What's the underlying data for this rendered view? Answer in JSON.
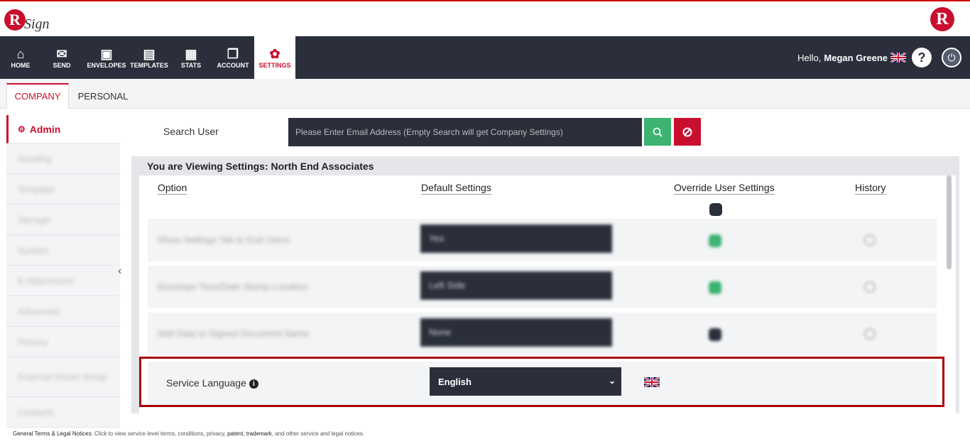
{
  "brand": {
    "logo_letter": "R",
    "logo_text": "Sign"
  },
  "nav": {
    "items": [
      {
        "label": "HOME",
        "icon": "home-icon"
      },
      {
        "label": "SEND",
        "icon": "envelope-icon"
      },
      {
        "label": "ENVELOPES",
        "icon": "inbox-icon"
      },
      {
        "label": "TEMPLATES",
        "icon": "document-icon"
      },
      {
        "label": "STATS",
        "icon": "briefcase-icon"
      },
      {
        "label": "ACCOUNT",
        "icon": "copy-icon"
      },
      {
        "label": "SETTINGS",
        "icon": "gear-icon",
        "active": true
      }
    ],
    "greeting": "Hello,",
    "user_name": "Megan Greene",
    "help_label": "?",
    "power_icon": "power-icon"
  },
  "tabs": {
    "company": "COMPANY",
    "personal": "PERSONAL"
  },
  "sidebar": {
    "items": [
      {
        "label": "Admin",
        "icon": "admin-icon",
        "active": true
      },
      {
        "label": "Sending"
      },
      {
        "label": "Template"
      },
      {
        "label": "Storage"
      },
      {
        "label": "System"
      },
      {
        "label": "E-Attachment"
      },
      {
        "label": "Advanced"
      },
      {
        "label": "Privacy"
      },
      {
        "label": "External Drives Setup"
      },
      {
        "label": "Contacts"
      }
    ]
  },
  "search": {
    "label": "Search User",
    "placeholder": "Please Enter Email Address (Empty Search will get Company Settings)"
  },
  "settings": {
    "viewing_label": "You are Viewing Settings: North End Associates",
    "columns": {
      "option": "Option",
      "default": "Default Settings",
      "override": "Override User Settings",
      "history": "History"
    },
    "rows": [
      {
        "option": "Show Settings Tab to End Users",
        "value": "Yes",
        "override_color": "#3cb371"
      },
      {
        "option": "Envelope Time/Date Stamp Location",
        "value": "Left Side",
        "override_color": "#3cb371"
      },
      {
        "option": "Add Date to Signed Document Name",
        "value": "None",
        "override_color": "#2a2f3b"
      }
    ],
    "service_language": {
      "label": "Service Language",
      "value": "English"
    }
  },
  "footer": {
    "prefix": "General Terms & Legal Notices",
    "text": ": Click to view service level terms, conditions, privacy,",
    "patent": "patent",
    "sep": ",",
    "trademark": "trademark",
    "suffix": ", and other service and legal notices."
  },
  "colors": {
    "brand_red": "#c8102e",
    "nav_bg": "#2a2f3b",
    "search_green": "#3cb371"
  }
}
